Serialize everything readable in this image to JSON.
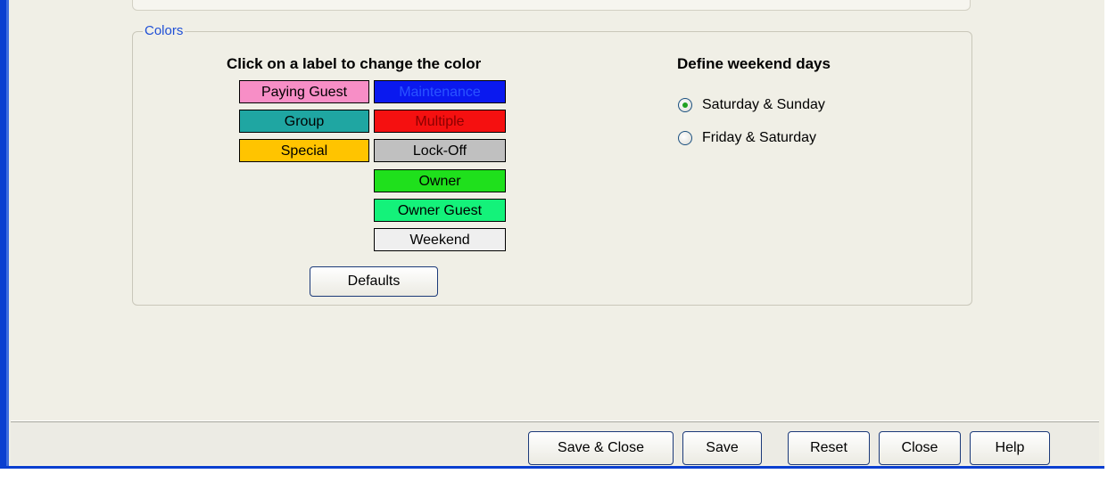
{
  "colors_group": {
    "legend": "Colors",
    "color_heading": "Click on a label to change the color",
    "labels": [
      {
        "text": "Paying Guest",
        "bg": "#f78ec6",
        "fg": "#000000"
      },
      {
        "text": "Group",
        "bg": "#1fa6a2",
        "fg": "#000000"
      },
      {
        "text": "Special",
        "bg": "#ffc400",
        "fg": "#000000"
      },
      {
        "text": "Maintenance",
        "bg": "#0a19ef",
        "fg": "#2a54ff"
      },
      {
        "text": "Multiple",
        "bg": "#f51010",
        "fg": "#8a0000"
      },
      {
        "text": "Lock-Off",
        "bg": "#c0c0c0",
        "fg": "#000000"
      },
      {
        "text": "Owner",
        "bg": "#1fe01c",
        "fg": "#000000"
      },
      {
        "text": "Owner Guest",
        "bg": "#14f27a",
        "fg": "#000000"
      },
      {
        "text": "Weekend",
        "bg": "#efefef",
        "fg": "#000000"
      }
    ],
    "defaults_button": "Defaults",
    "weekend_heading": "Define weekend days",
    "weekend_options": [
      {
        "label": "Saturday & Sunday",
        "selected": true
      },
      {
        "label": "Friday & Saturday",
        "selected": false
      }
    ]
  },
  "footer": {
    "save_close": "Save & Close",
    "save": "Save",
    "reset": "Reset",
    "close": "Close",
    "help": "Help"
  }
}
